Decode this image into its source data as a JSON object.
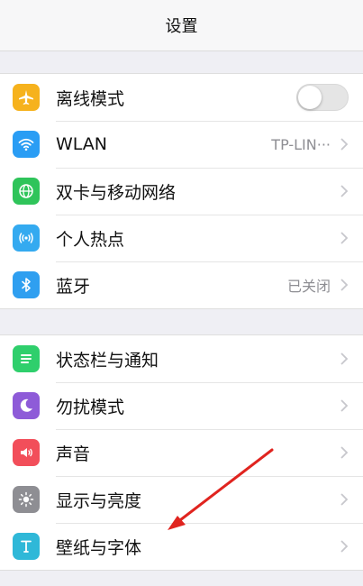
{
  "header": {
    "title": "设置"
  },
  "group1": [
    {
      "id": "airplane",
      "label": "离线模式",
      "icon": "airplane-icon",
      "color": "#f6b21d"
    },
    {
      "id": "wlan",
      "label": "WLAN",
      "value": "TP-LIN···",
      "icon": "wifi-icon",
      "color": "#2a9df4"
    },
    {
      "id": "cellular",
      "label": "双卡与移动网络",
      "icon": "globe-icon",
      "color": "#2fc45a"
    },
    {
      "id": "hotspot",
      "label": "个人热点",
      "icon": "hotspot-icon",
      "color": "#34aaf0"
    },
    {
      "id": "bluetooth",
      "label": "蓝牙",
      "value": "已关闭",
      "icon": "bluetooth-icon",
      "color": "#2f9ff0"
    }
  ],
  "group2": [
    {
      "id": "statusbar",
      "label": "状态栏与通知",
      "icon": "notification-icon",
      "color": "#2fcf6c"
    },
    {
      "id": "dnd",
      "label": "勿扰模式",
      "icon": "moon-icon",
      "color": "#8e5bd8"
    },
    {
      "id": "sound",
      "label": "声音",
      "icon": "speaker-icon",
      "color": "#f24e5a"
    },
    {
      "id": "display",
      "label": "显示与亮度",
      "icon": "sun-icon",
      "color": "#8e8e93"
    },
    {
      "id": "wallpaper",
      "label": "壁纸与字体",
      "icon": "font-icon",
      "color": "#2fb8d8"
    }
  ]
}
